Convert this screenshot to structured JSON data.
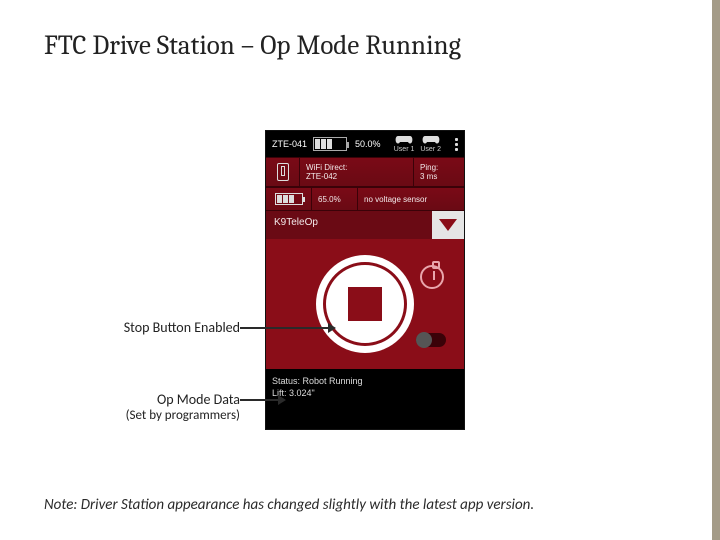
{
  "slide": {
    "title": "FTC Drive Station – Op Mode Running",
    "footnote": "Note: Driver Station appearance has changed slightly with the latest app version."
  },
  "callouts": {
    "stop_label": "Stop Button Enabled",
    "opmode_label": "Op Mode Data",
    "opmode_sub": "(Set by programmers)"
  },
  "phone": {
    "device": "ZTE-041",
    "ds_battery_pct": "50.0%",
    "gp1_label": "User 1",
    "gp2_label": "User 2",
    "wifi_label": "WiFi Direct:",
    "wifi_value": "ZTE-042",
    "ping_label": "Ping:",
    "ping_value": "3 ms",
    "rc_battery_pct": "65.0%",
    "voltage_sensor": "no voltage sensor",
    "opmode_name": "K9TeleOp",
    "telemetry": {
      "status": "Status: Robot Running",
      "lift": "Lift: 3.024\""
    }
  }
}
